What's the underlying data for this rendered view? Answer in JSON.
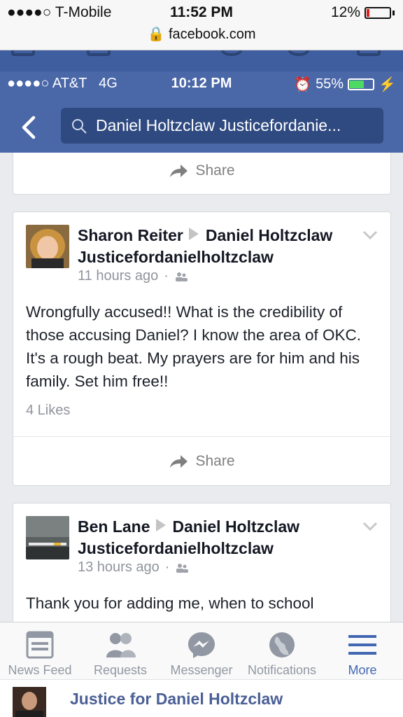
{
  "outer_status": {
    "carrier": "●●●●○ T-Mobile",
    "time": "11:52 PM",
    "battery": "12%",
    "url": "facebook.com"
  },
  "inner_status": {
    "carrier": "●●●●○ AT&T",
    "network": "4G",
    "time": "10:12 PM",
    "battery": "55%"
  },
  "search": {
    "query": "Daniel Holtzclaw Justicefordanie..."
  },
  "colors": {
    "fb_blue": "#4a67a8",
    "search_bg": "#2f4a80",
    "active_tab": "#4267b2"
  },
  "feed": {
    "share_label": "Share",
    "posts": [
      {
        "author": "Sharon Reiter",
        "target": "Daniel Holtzclaw",
        "target_line2": "Justicefordanielholtzclaw",
        "time": "11 hours ago",
        "body": "Wrongfully accused!! What is the credibility of those accusing Daniel? I know the area of OKC. It's a rough beat. My prayers are for him and his family. Set him free!!",
        "likes": "4 Likes"
      },
      {
        "author": "Ben Lane",
        "target": "Daniel Holtzclaw",
        "target_line2": "Justicefordanielholtzclaw",
        "time": "13 hours ago",
        "body": "Thank you for adding me,  when to school"
      }
    ]
  },
  "tabs": [
    {
      "label": "News Feed",
      "icon": "news-feed-icon"
    },
    {
      "label": "Requests",
      "icon": "friend-requests-icon"
    },
    {
      "label": "Messenger",
      "icon": "messenger-icon"
    },
    {
      "label": "Notifications",
      "icon": "globe-icon"
    },
    {
      "label": "More",
      "icon": "menu-icon"
    }
  ],
  "page_banner": {
    "name": "Justice for Daniel Holtzclaw"
  }
}
